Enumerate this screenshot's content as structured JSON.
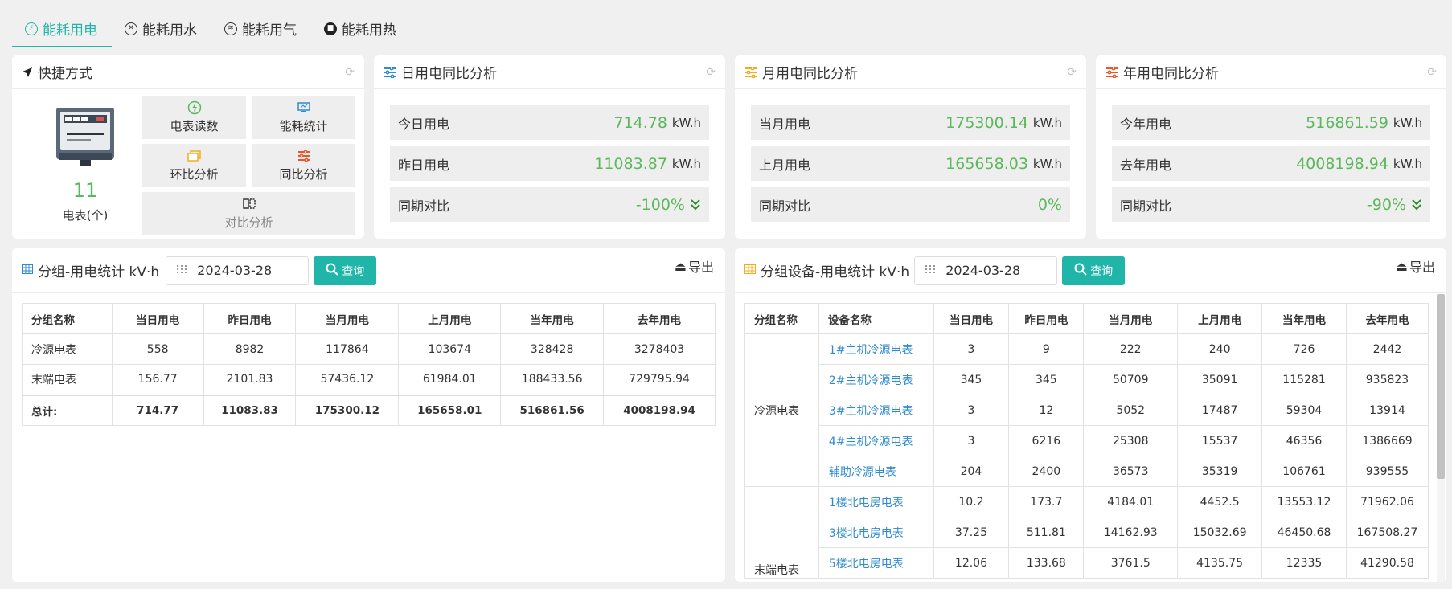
{
  "tabs": [
    {
      "label": "能耗用电",
      "icon": "lightning-icon",
      "active": true
    },
    {
      "label": "能耗用水",
      "icon": "water-icon",
      "active": false
    },
    {
      "label": "能耗用气",
      "icon": "gas-icon",
      "active": false
    },
    {
      "label": "能耗用热",
      "icon": "heat-icon",
      "active": false
    }
  ],
  "colors": {
    "accent": "#1fb5a8",
    "value_green": "#5cb85c",
    "link_blue": "#2f8bd0"
  },
  "quick": {
    "title": "快捷方式",
    "meter_count": "11",
    "meter_label": "电表(个)",
    "buttons": [
      {
        "label": "电表读数",
        "icon": "lightning-circle-icon"
      },
      {
        "label": "能耗统计",
        "icon": "monitor-icon"
      },
      {
        "label": "环比分析",
        "icon": "windows-icon"
      },
      {
        "label": "同比分析",
        "icon": "sliders-icon"
      },
      {
        "label": "对比分析",
        "icon": "compare-icon"
      }
    ]
  },
  "daily": {
    "title": "日用电同比分析",
    "rows": [
      {
        "label": "今日用电",
        "value": "714.78",
        "unit": "kW.h"
      },
      {
        "label": "昨日用电",
        "value": "11083.87",
        "unit": "kW.h"
      },
      {
        "label": "同期对比",
        "value": "-100%",
        "arrow": "down"
      }
    ]
  },
  "monthly": {
    "title": "月用电同比分析",
    "rows": [
      {
        "label": "当月用电",
        "value": "175300.14",
        "unit": "kW.h"
      },
      {
        "label": "上月用电",
        "value": "165658.03",
        "unit": "kW.h"
      },
      {
        "label": "同期对比",
        "value": "0%"
      }
    ]
  },
  "yearly": {
    "title": "年用电同比分析",
    "rows": [
      {
        "label": "今年用电",
        "value": "516861.59",
        "unit": "kW.h"
      },
      {
        "label": "去年用电",
        "value": "4008198.94",
        "unit": "kW.h"
      },
      {
        "label": "同期对比",
        "value": "-90%",
        "arrow": "down"
      }
    ]
  },
  "group_table": {
    "title": "分组-用电统计 kV·h",
    "date": "2024-03-28",
    "query_label": "查询",
    "export_label": "导出",
    "headers": [
      "分组名称",
      "当日用电",
      "昨日用电",
      "当月用电",
      "上月用电",
      "当年用电",
      "去年用电"
    ],
    "rows": [
      [
        "冷源电表",
        "558",
        "8982",
        "117864",
        "103674",
        "328428",
        "3278403"
      ],
      [
        "末端电表",
        "156.77",
        "2101.83",
        "57436.12",
        "61984.01",
        "188433.56",
        "729795.94"
      ]
    ],
    "total": [
      "总计:",
      "714.77",
      "11083.83",
      "175300.12",
      "165658.01",
      "516861.56",
      "4008198.94"
    ]
  },
  "device_table": {
    "title": "分组设备-用电统计 kV·h",
    "date": "2024-03-28",
    "query_label": "查询",
    "export_label": "导出",
    "headers": [
      "分组名称",
      "设备名称",
      "当日用电",
      "昨日用电",
      "当月用电",
      "上月用电",
      "当年用电",
      "去年用电"
    ],
    "groups": [
      {
        "name": "冷源电表",
        "rows": [
          [
            "1#主机冷源电表",
            "3",
            "9",
            "222",
            "240",
            "726",
            "2442"
          ],
          [
            "2#主机冷源电表",
            "345",
            "345",
            "50709",
            "35091",
            "115281",
            "935823"
          ],
          [
            "3#主机冷源电表",
            "3",
            "12",
            "5052",
            "17487",
            "59304",
            "13914"
          ],
          [
            "4#主机冷源电表",
            "3",
            "6216",
            "25308",
            "15537",
            "46356",
            "1386669"
          ],
          [
            "辅助冷源电表",
            "204",
            "2400",
            "36573",
            "35319",
            "106761",
            "939555"
          ]
        ]
      },
      {
        "name": "末端电表",
        "rows": [
          [
            "1楼北电房电表",
            "10.2",
            "173.7",
            "4184.01",
            "4452.5",
            "13553.12",
            "71962.06"
          ],
          [
            "3楼北电房电表",
            "37.25",
            "511.81",
            "14162.93",
            "15032.69",
            "46450.68",
            "167508.27"
          ],
          [
            "5楼北电房电表",
            "12.06",
            "133.68",
            "3761.5",
            "4135.75",
            "12335",
            "41290.58"
          ]
        ]
      }
    ]
  }
}
